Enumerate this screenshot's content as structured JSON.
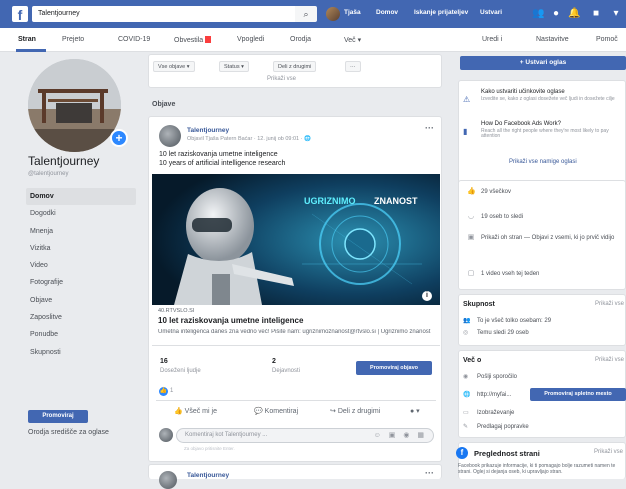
{
  "topbar": {
    "search_value": "Talentjourney",
    "user_name": "Tjaša",
    "links": [
      "Domov",
      "Iskanje prijateljev",
      "Ustvari"
    ],
    "colors": {
      "brand": "#4267b2",
      "accent": "#2d88ff"
    }
  },
  "navbar": {
    "tabs": [
      "Stran",
      "Prejeto",
      "COVID-19",
      "Obvestila",
      "Vpogledi",
      "Orodja",
      "Več ▾"
    ],
    "right_tabs": [
      "Uredi i",
      "Nastavitve",
      "Pomoč"
    ]
  },
  "left": {
    "page_name": "Talentjourney",
    "handle": "@talentjourney",
    "nav": [
      "Domov",
      "Dogodki",
      "Mnenja",
      "Vizitka",
      "Video",
      "Fotografije",
      "Objave",
      "Zaposlitve",
      "Ponudbe",
      "Skupnosti"
    ],
    "promote_label": "Promoviraj",
    "footer": "Orodja središče za oglase"
  },
  "feed": {
    "filters": [
      "Vse objave ▾",
      "Status ▾",
      "Deli z drugimi",
      "···"
    ],
    "show_all": "Prikaži vse",
    "section_title": "Objave",
    "post": {
      "author": "Talentjourney",
      "meta": "Objavil Tjaša Patern Baćar · 12. junij ob 09:01 · 🌐",
      "text_line1": "10 let raziskovanja umetne inteligence",
      "text_line2": "10 years of artificial intelligence research",
      "image_overlay_1": "UGRIZNIMO",
      "image_overlay_2": "ZNANOST",
      "link_domain": "40.RTVSLO.SI",
      "link_title": "10 let raziskovanja umetne inteligence",
      "link_desc": "Umetna inteligenca danes zna vedno več! Pišite nam: ugriznimoznanost@rtvslo.si | Ugriznimo znanost",
      "stat1_value": "16",
      "stat1_label": "Doseženi ljudje",
      "stat2_value": "2",
      "stat2_label": "Dejavnosti",
      "boost_label": "Promoviraj objavo",
      "reactions": "1",
      "actions": [
        "Všeč mi je",
        "Komentiraj",
        "Deli z drugimi"
      ],
      "comment_placeholder": "Komentiraj kot Talentjourney ...",
      "comment_hint": "Za objavo pritisnite Enter."
    },
    "post2_author": "Talentjourney"
  },
  "right": {
    "create_ad": "+ Ustvari oglas",
    "tips": [
      {
        "title": "Kako ustvariti učinkovite oglase",
        "sub": "Izvedite se, kako z oglasi dosežete več ljudi in dosežete cilje"
      },
      {
        "title": "How Do Facebook Ads Work?",
        "sub": "Reach all the right people where they're most likely to pay attention"
      }
    ],
    "see_all_tips": "Prikaži vse namige oglasi",
    "stats": [
      "29 všečkov",
      "19 oseb to sledi",
      "Prikaži oh stran — Objavi z vsemi, ki jo prvič vidijo",
      "1 video vseh tej teden"
    ],
    "group": {
      "title": "Skupnost",
      "link": "Prikaži vse",
      "rows": [
        "To je všeč tolko osebam: 29",
        "Temu sledi 29 oseb"
      ]
    },
    "about": {
      "title": "Več o",
      "link": "Prikaži vse",
      "rows": [
        "Pošlji sporočilo",
        "http://myfai...",
        "Izobraževanje",
        "Predlagaj popravke"
      ],
      "button": "Promoviraj spletno mesto"
    },
    "transparency": {
      "title": "Preglednost strani",
      "link": "Prikaži vse",
      "text": "Facebook prikazuje informacije, ki ti pomagajo bolje razumeti namen te strani. Oglej si dejanja oseb, ki upravljajo stran."
    }
  }
}
